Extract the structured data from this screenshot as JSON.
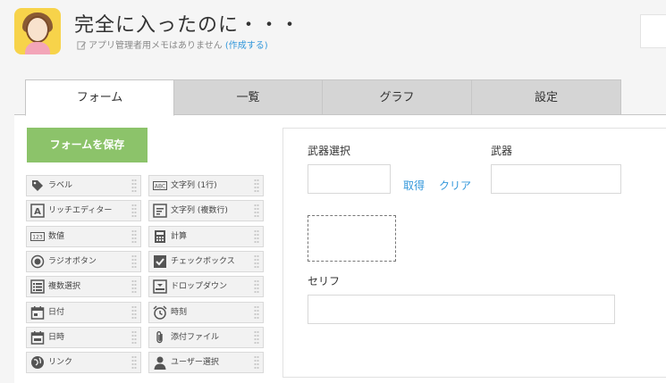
{
  "app": {
    "title": "完全に入ったのに・・・",
    "memo_text": "アプリ管理者用メモはありません",
    "memo_link": "(作成する)"
  },
  "tabs": [
    "フォーム",
    "一覧",
    "グラフ",
    "設定"
  ],
  "palette": {
    "save_label": "フォームを保存",
    "items": [
      {
        "label": "ラベル",
        "icon": "label-tag-icon"
      },
      {
        "label": "文字列 (1行)",
        "icon": "abc-text-icon"
      },
      {
        "label": "リッチエディター",
        "icon": "rich-editor-icon"
      },
      {
        "label": "文字列 (複数行)",
        "icon": "multiline-text-icon"
      },
      {
        "label": "数値",
        "icon": "number-icon"
      },
      {
        "label": "計算",
        "icon": "calculator-icon"
      },
      {
        "label": "ラジオボタン",
        "icon": "radio-icon"
      },
      {
        "label": "チェックボックス",
        "icon": "checkbox-icon"
      },
      {
        "label": "複数選択",
        "icon": "multi-select-icon"
      },
      {
        "label": "ドロップダウン",
        "icon": "dropdown-icon"
      },
      {
        "label": "日付",
        "icon": "calendar-icon"
      },
      {
        "label": "時刻",
        "icon": "clock-icon"
      },
      {
        "label": "日時",
        "icon": "datetime-icon"
      },
      {
        "label": "添付ファイル",
        "icon": "paperclip-icon"
      },
      {
        "label": "リンク",
        "icon": "globe-link-icon"
      },
      {
        "label": "ユーザー選択",
        "icon": "user-icon"
      }
    ]
  },
  "form": {
    "weapon_select_label": "武器選択",
    "fetch_label": "取得",
    "clear_label": "クリア",
    "weapon_label": "武器",
    "serif_label": "セリフ"
  },
  "colors": {
    "save_button": "#8cc36a",
    "link": "#3498db",
    "tab_inactive": "#d5d5d5"
  }
}
